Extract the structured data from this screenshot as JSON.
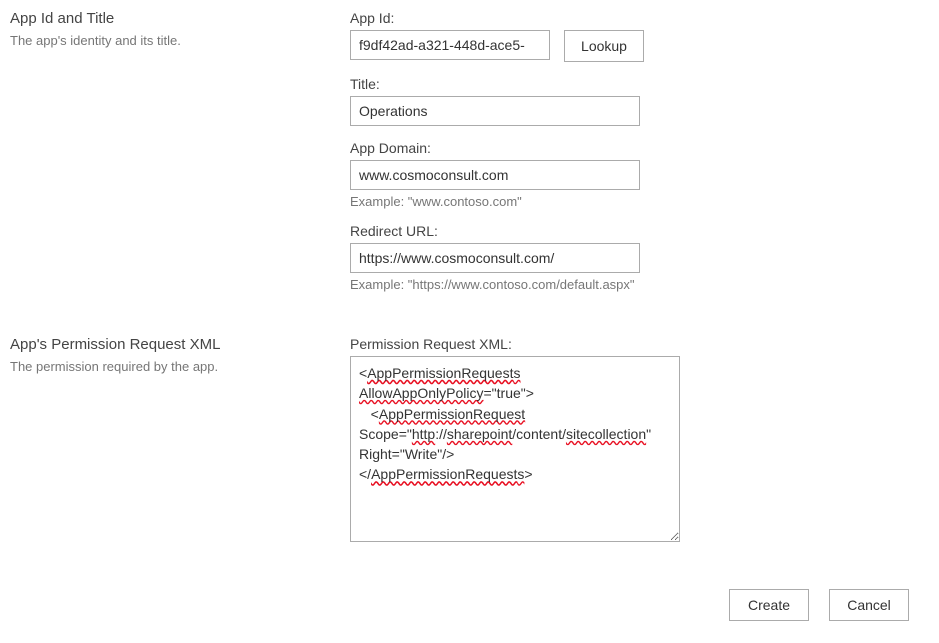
{
  "section1": {
    "title": "App Id and Title",
    "desc": "The app's identity and its title."
  },
  "appId": {
    "label": "App Id:",
    "value": "f9df42ad-a321-448d-ace5-",
    "lookupLabel": "Lookup"
  },
  "title": {
    "label": "Title:",
    "value": "Operations"
  },
  "appDomain": {
    "label": "App Domain:",
    "value": "www.cosmoconsult.com",
    "hint": "Example: \"www.contoso.com\""
  },
  "redirect": {
    "label": "Redirect URL:",
    "value": "https://www.cosmoconsult.com/",
    "hint": "Example: \"https://www.contoso.com/default.aspx\""
  },
  "section2": {
    "title": "App's Permission Request XML",
    "desc": "The permission required by the app."
  },
  "permXml": {
    "label": "Permission Request XML:",
    "value": "<AppPermissionRequests AllowAppOnlyPolicy=\"true\">\n   <AppPermissionRequest Scope=\"http://sharepoint/content/sitecollection\" Right=\"Write\"/>\n</AppPermissionRequests>"
  },
  "footer": {
    "create": "Create",
    "cancel": "Cancel"
  }
}
